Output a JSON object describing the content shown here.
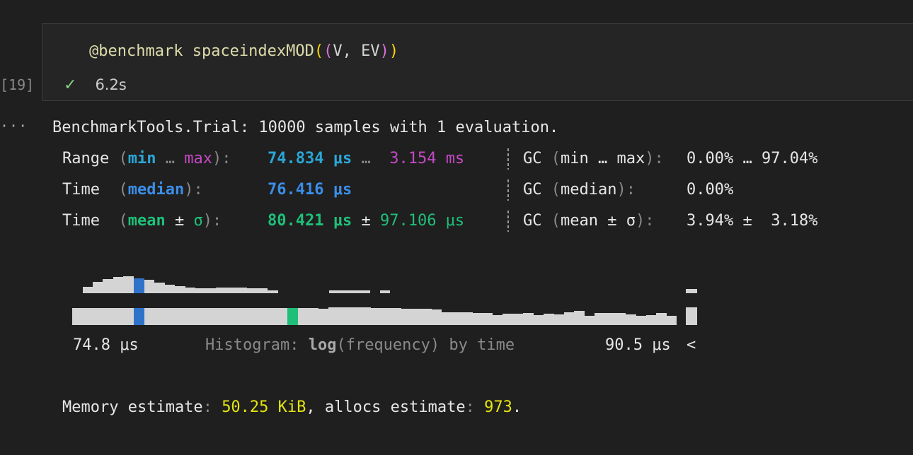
{
  "cell": {
    "exec_count": "[19]",
    "code": {
      "macro": "@benchmark",
      "fn": "spaceindexMOD",
      "open1": "(",
      "open2": "(",
      "args": "V, EV",
      "close2": ")",
      "close1": ")"
    },
    "status_time": "6.2s"
  },
  "output": {
    "more": "···",
    "header": "BenchmarkTools.Trial: 10000 samples with 1 evaluation.",
    "range": {
      "label": "Range",
      "p_open": "(",
      "min": "min",
      "ellipsis": "…",
      "max": "max",
      "p_close": "):",
      "min_val": "74.834 μs",
      "sep": "…",
      "max_val": "3.154 ms",
      "gc_label": "GC",
      "gc_open": "(",
      "gc_min": "min … max",
      "gc_close": "):",
      "gc_vals": "0.00% … 97.04%"
    },
    "median": {
      "label": "Time",
      "p_open": "(",
      "stat": "median",
      "p_close": "):",
      "val": "76.416 μs",
      "gc_label": "GC",
      "gc_open": "(",
      "gc_stat": "median",
      "gc_close": "):",
      "gc_val": "0.00%"
    },
    "mean": {
      "label": "Time",
      "p_open": "(",
      "stat": "mean",
      "pm": "±",
      "sigma": "σ",
      "p_close": "):",
      "val": "80.421 μs",
      "pm2": "±",
      "sd": "97.106 μs",
      "gc_label": "GC",
      "gc_open": "(",
      "gc_stat": "mean ± σ",
      "gc_close": "):",
      "gc_val": "3.94% ±  3.18%"
    },
    "histogram": {
      "min_label": "74.8 μs",
      "caption_prefix": "Histogram: ",
      "caption_log": "log",
      "caption_rest": "(frequency) by time",
      "max_label": "90.5 μs",
      "overflow": "<"
    },
    "memory": {
      "label1": "Memory estimate",
      "colon1": ":",
      "mem_val": "50.25 KiB",
      "sep": ", allocs estimate",
      "colon2": ":",
      "allocs_val": "973",
      "end": "."
    }
  },
  "colors": {
    "bar": "#d4d4d4",
    "median_marker": "#2e73c9",
    "mean_marker": "#1fbf7a",
    "min_accent": "#2aa7d6",
    "max_accent": "#c549c5",
    "value_accent": "#e5e510"
  }
}
